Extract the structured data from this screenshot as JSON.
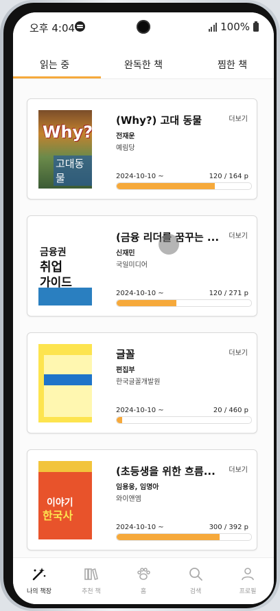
{
  "status_bar": {
    "time": "오후 4:04",
    "battery": "100%"
  },
  "tabs": [
    {
      "label": "읽는 중",
      "active": true
    },
    {
      "label": "완독한 책",
      "active": false
    },
    {
      "label": "찜한 책",
      "active": false
    }
  ],
  "books": [
    {
      "title": "(Why?) 고대 동물",
      "author": "전재운",
      "publisher": "예림당",
      "more": "더보기",
      "date": "2024-10-10 ~",
      "pages": "120 / 164 p",
      "progress": 0.732,
      "cover_text": [
        "Why?",
        "고대동물"
      ]
    },
    {
      "title": "(금융 리더를 꿈꾸는 ...",
      "author": "신재민",
      "publisher": "국일미디어",
      "more": "더보기",
      "date": "2024-10-10 ~",
      "pages": "120 / 271 p",
      "progress": 0.443,
      "cover_text": [
        "금융권",
        "취업",
        "가이드"
      ]
    },
    {
      "title": "글꼴",
      "author": "편집부",
      "publisher": "한국글꼴개발원",
      "more": "더보기",
      "date": "2024-10-10 ~",
      "pages": "20 / 460 p",
      "progress": 0.043,
      "cover_text": []
    },
    {
      "title": "(초등생을 위한 흐름...",
      "author": "임용웅, 임명아",
      "publisher": "와이앤엠",
      "more": "더보기",
      "date": "2024-10-10 ~",
      "pages": "300 / 392 p",
      "progress": 0.765,
      "cover_text": [
        "이야기",
        "한국사"
      ]
    }
  ],
  "bottom_nav": [
    {
      "label": "나의 책장",
      "icon": "magic-wand-icon",
      "active": true
    },
    {
      "label": "추천 책",
      "icon": "books-icon",
      "active": false
    },
    {
      "label": "홈",
      "icon": "paw-icon",
      "active": false
    },
    {
      "label": "검색",
      "icon": "search-icon",
      "active": false
    },
    {
      "label": "프로필",
      "icon": "profile-icon",
      "active": false
    }
  ],
  "colors": {
    "accent": "#f6a93b"
  }
}
